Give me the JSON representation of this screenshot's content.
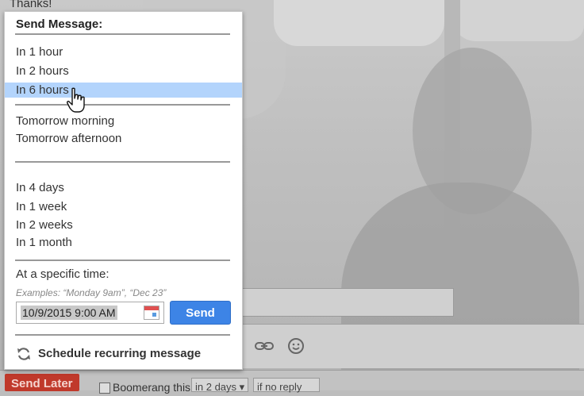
{
  "background": {
    "thanks_text": "Thanks!"
  },
  "menu": {
    "title": "Send Message:",
    "group1": [
      "In 1 hour",
      "In 2 hours",
      "In 6 hours"
    ],
    "selected": "In 6 hours",
    "group2": [
      "Tomorrow morning",
      "Tomorrow afternoon"
    ],
    "group3": [
      "In 4 days",
      "In 1 week",
      "In 2 weeks",
      "In 1 month"
    ],
    "specific_label": "At a specific time:",
    "examples": "Examples: “Monday 9am”, “Dec 23”",
    "date_value": "10/9/2015 9:00 AM",
    "send_label": "Send",
    "recurring_label": "Schedule recurring message"
  },
  "bottom_bar": {
    "send_later_label": "Send Later",
    "boomerang_label": "Boomerang this",
    "boomerang_select": "in 2 days",
    "noreply_select": "if no reply"
  },
  "colors": {
    "highlight": "#b3d4fc",
    "send_button": "#3d84e6",
    "send_later": "#c0392b"
  }
}
